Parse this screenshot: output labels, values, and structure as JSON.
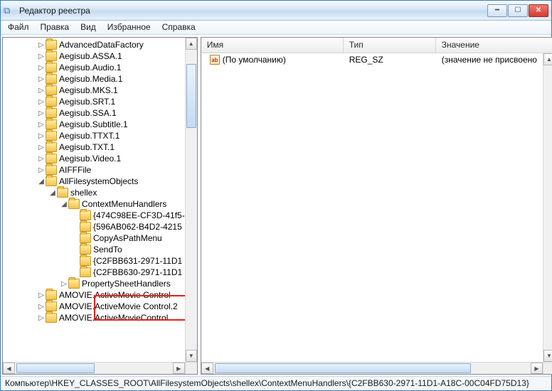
{
  "window": {
    "title": "Редактор реестра"
  },
  "menu": {
    "file": "Файл",
    "edit": "Правка",
    "view": "Вид",
    "fav": "Избранное",
    "help": "Справка"
  },
  "tree": [
    {
      "indent": 3,
      "exp": "▷",
      "label": "AdvancedDataFactory"
    },
    {
      "indent": 3,
      "exp": "▷",
      "label": "Aegisub.ASSA.1"
    },
    {
      "indent": 3,
      "exp": "▷",
      "label": "Aegisub.Audio.1"
    },
    {
      "indent": 3,
      "exp": "▷",
      "label": "Aegisub.Media.1"
    },
    {
      "indent": 3,
      "exp": "▷",
      "label": "Aegisub.MKS.1"
    },
    {
      "indent": 3,
      "exp": "▷",
      "label": "Aegisub.SRT.1"
    },
    {
      "indent": 3,
      "exp": "▷",
      "label": "Aegisub.SSA.1"
    },
    {
      "indent": 3,
      "exp": "▷",
      "label": "Aegisub.Subtitle.1"
    },
    {
      "indent": 3,
      "exp": "▷",
      "label": "Aegisub.TTXT.1"
    },
    {
      "indent": 3,
      "exp": "▷",
      "label": "Aegisub.TXT.1"
    },
    {
      "indent": 3,
      "exp": "▷",
      "label": "Aegisub.Video.1"
    },
    {
      "indent": 3,
      "exp": "▷",
      "label": "AIFFFile"
    },
    {
      "indent": 3,
      "exp": "◢",
      "label": "AllFilesystemObjects"
    },
    {
      "indent": 4,
      "exp": "◢",
      "label": "shellex"
    },
    {
      "indent": 5,
      "exp": "◢",
      "label": "ContextMenuHandlers"
    },
    {
      "indent": 6,
      "exp": "",
      "label": "{474C98EE-CF3D-41f5-"
    },
    {
      "indent": 6,
      "exp": "",
      "label": "{596AB062-B4D2-4215"
    },
    {
      "indent": 6,
      "exp": "",
      "label": "CopyAsPathMenu"
    },
    {
      "indent": 6,
      "exp": "",
      "label": "SendTo"
    },
    {
      "indent": 6,
      "exp": "",
      "label": "{C2FBB631-2971-11D1"
    },
    {
      "indent": 6,
      "exp": "",
      "label": "{C2FBB630-2971-11D1"
    },
    {
      "indent": 5,
      "exp": "▷",
      "label": "PropertySheetHandlers"
    },
    {
      "indent": 3,
      "exp": "▷",
      "label": "AMOVIE.ActiveMovie Control"
    },
    {
      "indent": 3,
      "exp": "▷",
      "label": "AMOVIE.ActiveMovie Control.2"
    },
    {
      "indent": 3,
      "exp": "▷",
      "label": "AMOVIE.ActiveMovieControl"
    }
  ],
  "list": {
    "cols": {
      "name": "Имя",
      "type": "Тип",
      "value": "Значение"
    },
    "rows": [
      {
        "name": "(По умолчанию)",
        "type": "REG_SZ",
        "value": "(значение не присвоено"
      }
    ]
  },
  "status": "Компьютер\\HKEY_CLASSES_ROOT\\AllFilesystemObjects\\shellex\\ContextMenuHandlers\\{C2FBB630-2971-11D1-A18C-00C04FD75D13}"
}
